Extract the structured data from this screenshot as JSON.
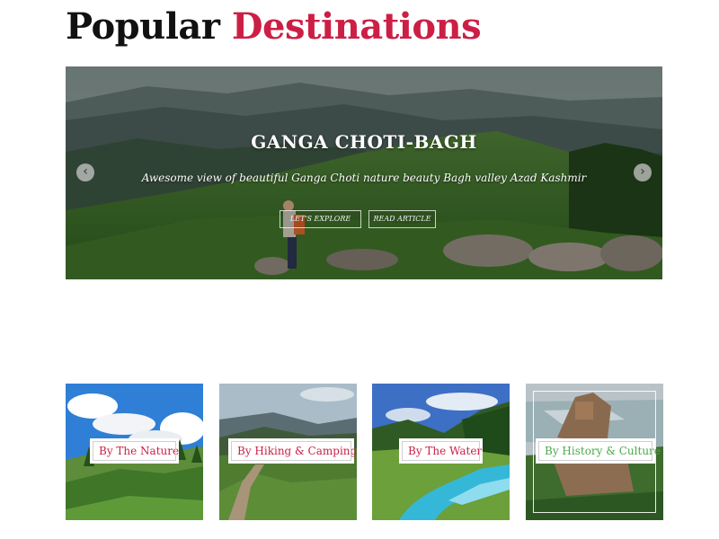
{
  "header": {
    "title_part1": "Popular",
    "title_part2": "Destinations"
  },
  "slider": {
    "title": "GANGA CHOTI-BAGH",
    "description": "Awesome view of beautiful Ganga Choti nature beauty Bagh valley Azad Kashmir",
    "buttons": {
      "explore": "LET'S EXPLORE",
      "read": "READ ARTICLE"
    },
    "prev_arrow": "‹",
    "next_arrow": "›"
  },
  "categories": [
    {
      "label": "By The Nature",
      "color": "#cc1f45"
    },
    {
      "label": "By Hiking & Camping",
      "color": "#cc1f45"
    },
    {
      "label": "By The Water",
      "color": "#cc1f45"
    },
    {
      "label": "By History & Culture",
      "color": "#4aa94a"
    }
  ],
  "colors": {
    "accent": "#cc1f45",
    "history_accent": "#4aa94a",
    "title_dark": "#111111"
  }
}
